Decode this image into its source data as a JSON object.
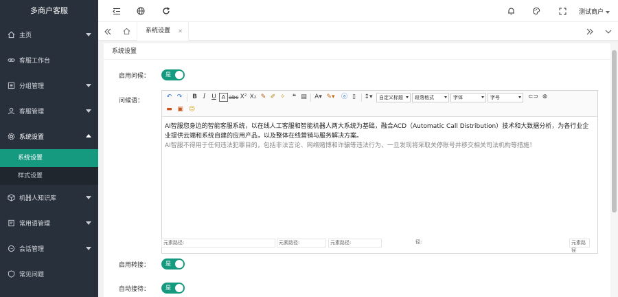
{
  "app": {
    "title": "多商户客服"
  },
  "sidebar": {
    "items": [
      {
        "label": "主页",
        "icon": "home-icon",
        "has_caret": true
      },
      {
        "label": "客服工作台",
        "icon": "link-icon",
        "has_caret": false
      },
      {
        "label": "分组管理",
        "icon": "group-icon",
        "has_caret": true
      },
      {
        "label": "客服管理",
        "icon": "user-icon",
        "has_caret": true
      },
      {
        "label": "系统设置",
        "icon": "gear-icon",
        "has_caret": true,
        "open": true
      },
      {
        "label": "机器人知识库",
        "icon": "cube-icon",
        "has_caret": true
      },
      {
        "label": "常用语管理",
        "icon": "note-icon",
        "has_caret": true
      },
      {
        "label": "会话管理",
        "icon": "chat-icon",
        "has_caret": true
      },
      {
        "label": "常见问题",
        "icon": "question-icon",
        "has_caret": false
      }
    ],
    "sub_items": [
      {
        "label": "系统设置",
        "active": true
      },
      {
        "label": "样式设置",
        "active": false
      }
    ]
  },
  "header": {
    "user": "测试商户"
  },
  "tabs": [
    {
      "label": "系统设置"
    }
  ],
  "content": {
    "title": "系统设置",
    "enable_greeting_label": "启用问候：",
    "greeting_label": "问候语：",
    "enable_transfer_label": "启用转接：",
    "auto_reply_label": "自动接待：",
    "switch_on_label": "是"
  },
  "editor": {
    "toolbar": {
      "custom_title": "自定义标题",
      "paragraph_format": "段落格式",
      "font": "字体",
      "font_size": "字号"
    },
    "paragraph1": "AI智服您身边的智能客服系统，以在线人工客服和智能机器人两大系统为基础，融合ACD（Automatic Call Distribution）技术和大数据分析，为各行业企业提供云端和系统自建的应用产品，以及整体在线营销与服务解决方案。",
    "paragraph2": "AI智服不得用于任何违法犯罪目的，包括非法言论、网络赌博和诈骗等违法行为，一旦发现将采取关停账号并移交相关司法机构等措施！",
    "status_labels": [
      "元素路径:",
      "元素路径:",
      "元素路径:",
      "径:",
      "元素路径"
    ]
  },
  "colors": {
    "accent": "#159a80",
    "sidebar_bg": "#28303b"
  }
}
